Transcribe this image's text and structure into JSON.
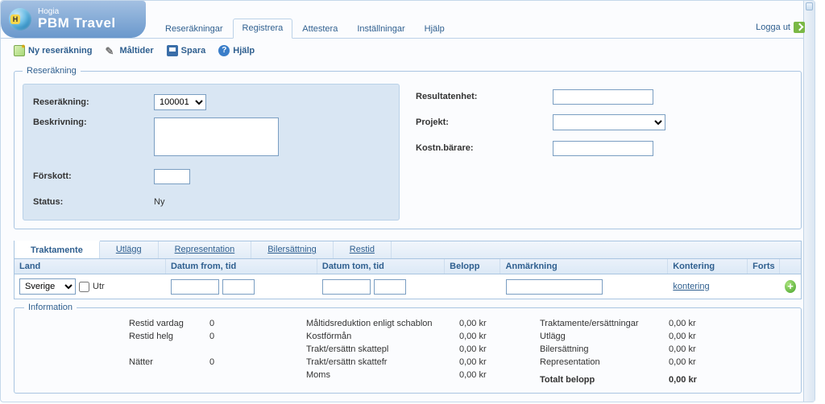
{
  "brand": {
    "small": "Hogia",
    "big": "PBM Travel"
  },
  "topnav": {
    "items": [
      "Reseräkningar",
      "Registrera",
      "Attestera",
      "Inställningar",
      "Hjälp"
    ],
    "active_index": 1,
    "logout": "Logga ut"
  },
  "toolbar": {
    "new": "Ny reseräkning",
    "meals": "Måltider",
    "save": "Spara",
    "help": "Hjälp"
  },
  "fieldset": {
    "legend": "Reseräkning",
    "left": {
      "reserakning_label": "Reseräkning:",
      "reserakning_value": "100001",
      "beskrivning_label": "Beskrivning:",
      "beskrivning_value": "",
      "forskott_label": "Förskott:",
      "forskott_value": "",
      "status_label": "Status:",
      "status_value": "Ny"
    },
    "right": {
      "resultatenhet_label": "Resultatenhet:",
      "resultatenhet_value": "",
      "projekt_label": "Projekt:",
      "projekt_value": "",
      "kostnbarare_label": "Kostn.bärare:",
      "kostnbarare_value": ""
    }
  },
  "subtabs": {
    "items": [
      "Traktamente",
      "Utlägg",
      "Representation",
      "Bilersättning",
      "Restid"
    ],
    "active_index": 0
  },
  "table": {
    "headers": {
      "land": "Land",
      "from": "Datum from, tid",
      "to": "Datum tom, tid",
      "belopp": "Belopp",
      "anm": "Anmärkning",
      "kontering": "Kontering",
      "forts": "Forts"
    },
    "row": {
      "land_value": "Sverige",
      "utr_label": "Utr",
      "from_date": "",
      "from_time": "",
      "to_date": "",
      "to_time": "",
      "belopp": "",
      "anm": "",
      "kontering_link": "kontering"
    }
  },
  "info": {
    "legend": "Information",
    "col1": {
      "restid_vardag_label": "Restid vardag",
      "restid_vardag_value": "0",
      "restid_helg_label": "Restid helg",
      "restid_helg_value": "0",
      "natter_label": "Nätter",
      "natter_value": "0"
    },
    "col2": {
      "maltids_label": "Måltidsreduktion enligt schablon",
      "maltids_value": "0,00 kr",
      "kostforman_label": "Kostförmån",
      "kostforman_value": "0,00 kr",
      "trakt_skattepl_label": "Trakt/ersättn skattepl",
      "trakt_skattepl_value": "0,00 kr",
      "trakt_skattefr_label": "Trakt/ersättn skattefr",
      "trakt_skattefr_value": "0,00 kr",
      "moms_label": "Moms",
      "moms_value": "0,00 kr"
    },
    "col3": {
      "traktamente_label": "Traktamente/ersättningar",
      "traktamente_value": "0,00 kr",
      "utlagg_label": "Utlägg",
      "utlagg_value": "0,00 kr",
      "bilers_label": "Bilersättning",
      "bilers_value": "0,00 kr",
      "repr_label": "Representation",
      "repr_value": "0,00 kr",
      "totalt_label": "Totalt belopp",
      "totalt_value": "0,00 kr"
    }
  }
}
